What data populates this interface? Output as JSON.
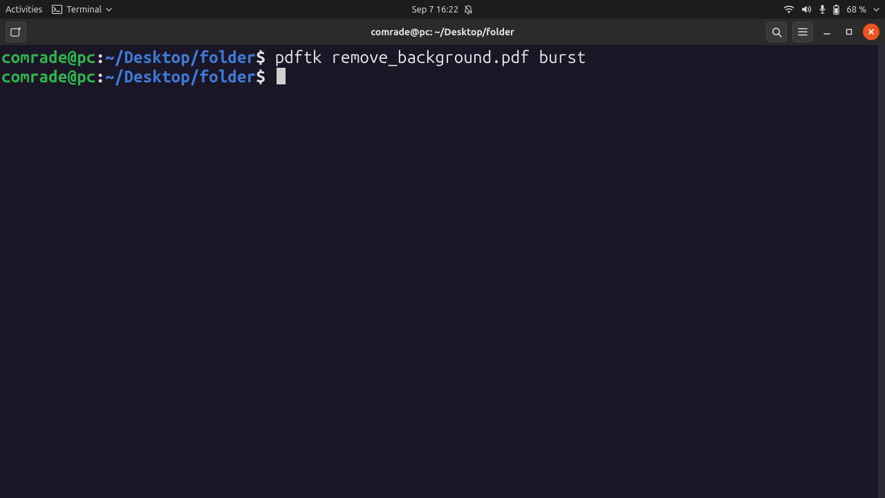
{
  "panel": {
    "activities": "Activities",
    "app_name": "Terminal",
    "clock": "Sep 7  16:22",
    "battery": "68 %"
  },
  "window": {
    "title": "comrade@pc: ~/Desktop/folder"
  },
  "prompt": {
    "userhost": "comrade@pc",
    "colon": ":",
    "path": "~/Desktop/folder",
    "symbol": "$"
  },
  "lines": {
    "cmd1": "pdftk remove_background.pdf burst"
  }
}
